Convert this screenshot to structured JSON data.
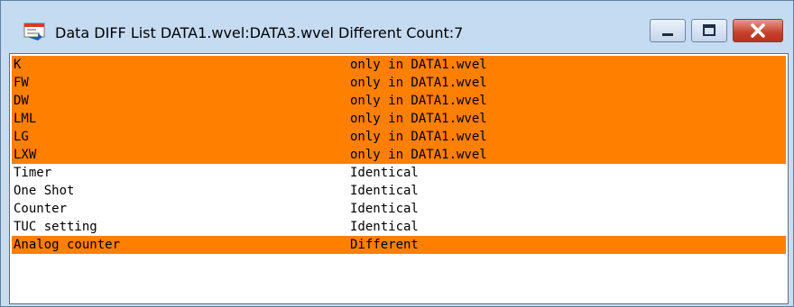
{
  "window": {
    "title": "Data DIFF List  DATA1.wvel:DATA3.wvel  Different Count:7",
    "icon": "diff-list-icon",
    "controls": [
      "minimize",
      "maximize",
      "close"
    ]
  },
  "colors": {
    "highlight": "#ff7f00",
    "normal": "#ffffff"
  },
  "rows": [
    {
      "name": "K",
      "result": "only in DATA1.wvel",
      "highlighted": true
    },
    {
      "name": "FW",
      "result": "only in DATA1.wvel",
      "highlighted": true
    },
    {
      "name": "DW",
      "result": "only in DATA1.wvel",
      "highlighted": true
    },
    {
      "name": "LML",
      "result": "only in DATA1.wvel",
      "highlighted": true
    },
    {
      "name": "LG",
      "result": "only in DATA1.wvel",
      "highlighted": true
    },
    {
      "name": "LXW",
      "result": "only in DATA1.wvel",
      "highlighted": true
    },
    {
      "name": "Timer",
      "result": "Identical",
      "highlighted": false
    },
    {
      "name": "One Shot",
      "result": "Identical",
      "highlighted": false
    },
    {
      "name": "Counter",
      "result": "Identical",
      "highlighted": false
    },
    {
      "name": "TUC setting",
      "result": "Identical",
      "highlighted": false
    },
    {
      "name": "Analog counter",
      "result": "Different",
      "highlighted": true
    }
  ]
}
